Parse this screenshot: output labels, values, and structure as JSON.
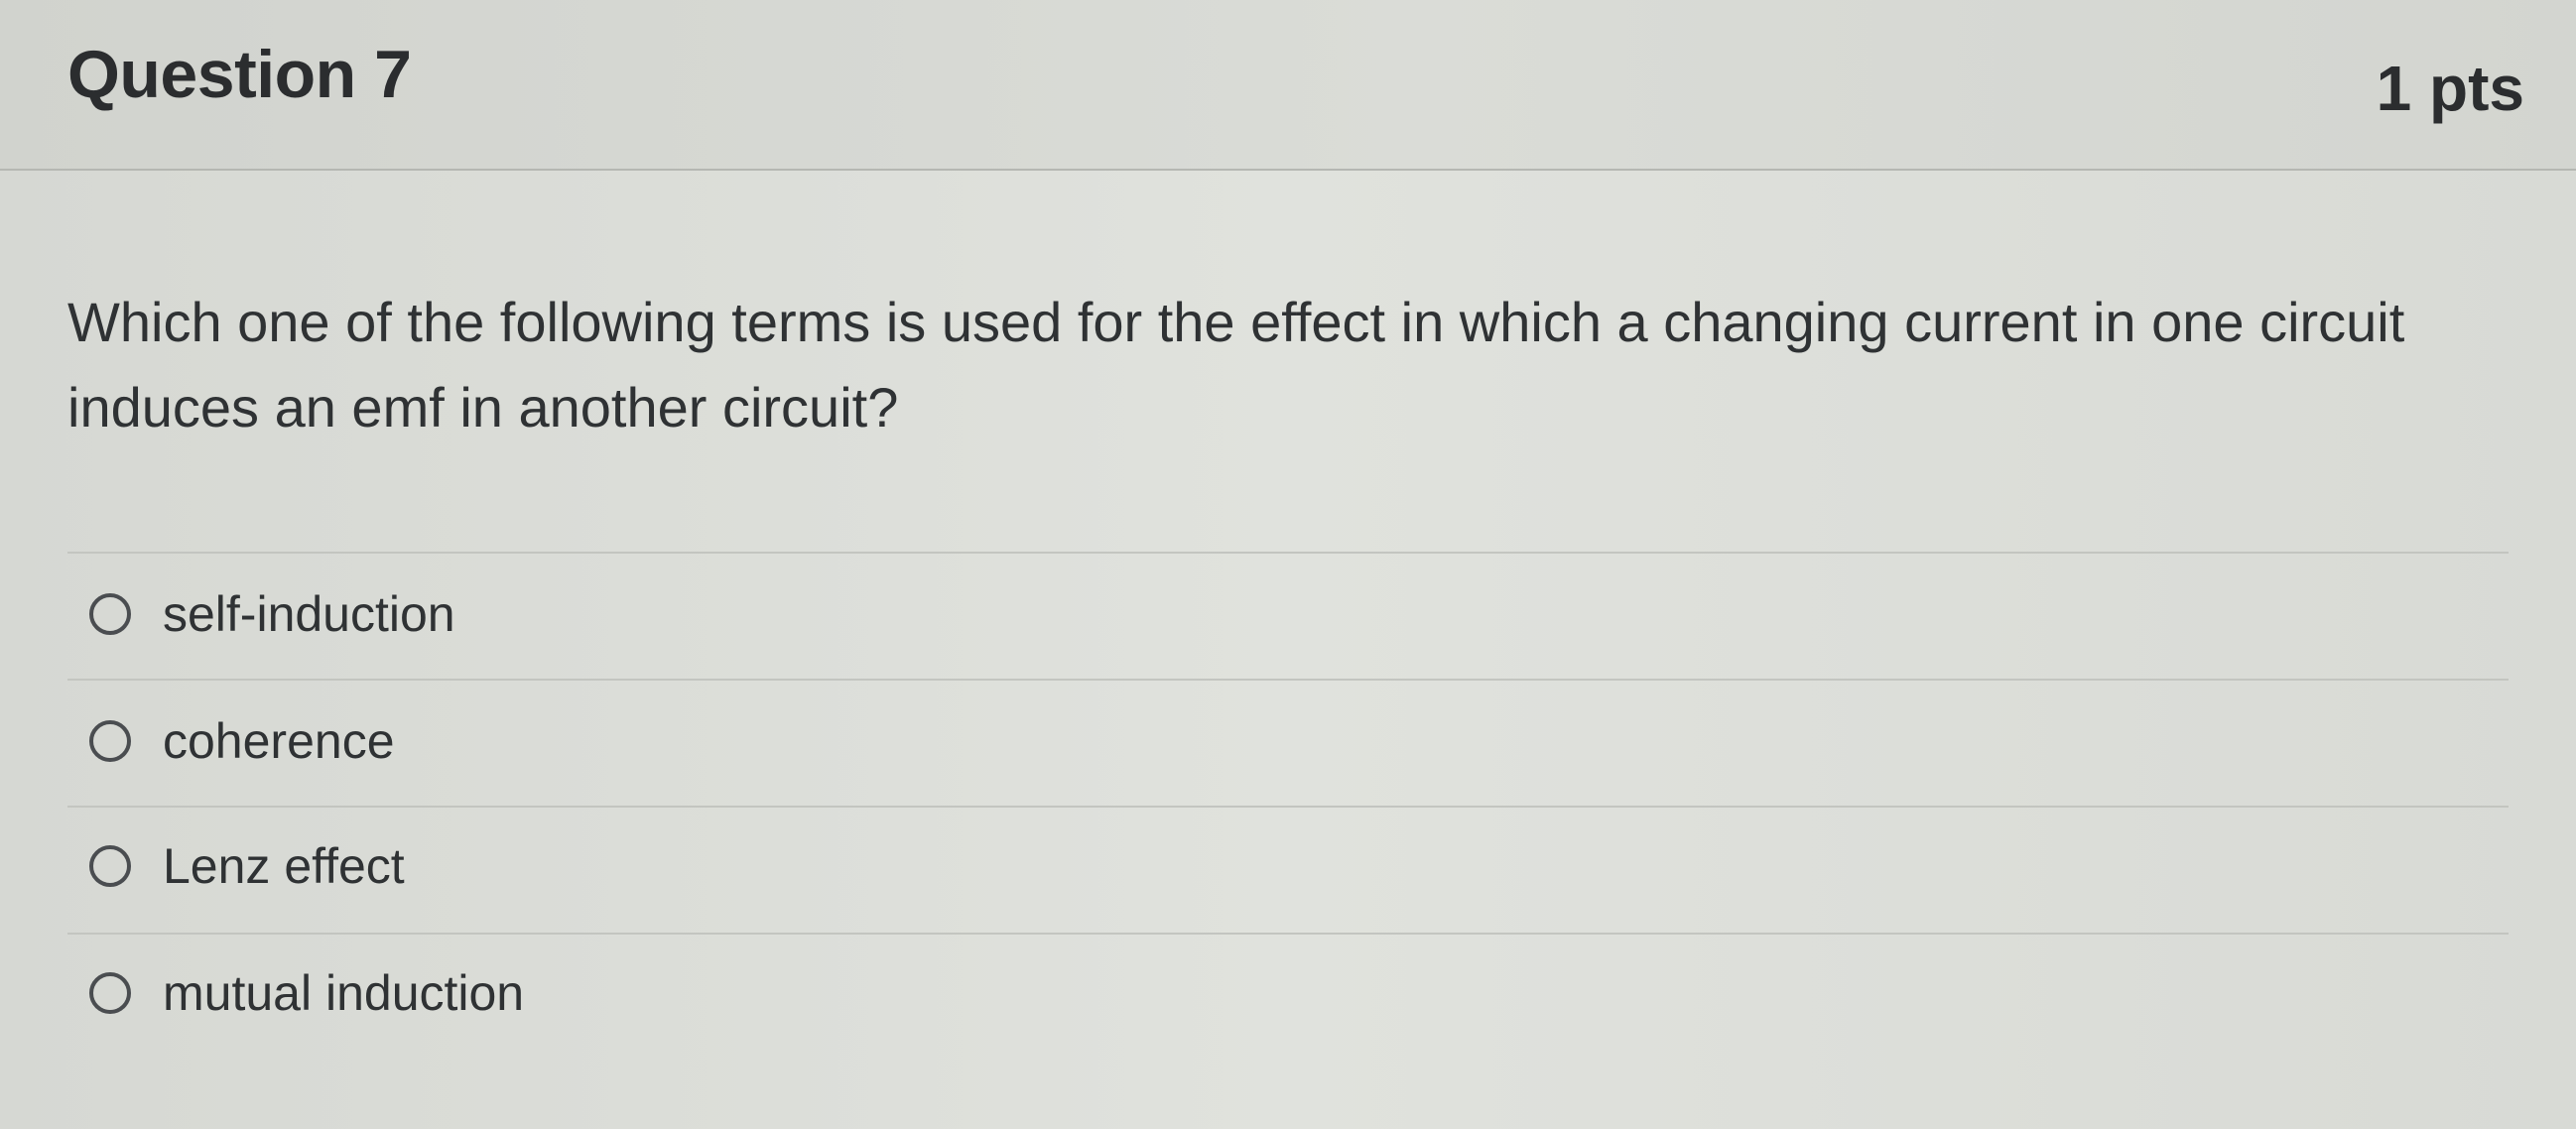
{
  "question": {
    "title": "Question 7",
    "points": "1 pts",
    "text": "Which one of the following terms is used for the effect in which a changing current in one circuit induces an emf in another circuit?"
  },
  "answers": [
    {
      "label": "self-induction"
    },
    {
      "label": "coherence"
    },
    {
      "label": "Lenz effect"
    },
    {
      "label": "mutual induction"
    }
  ]
}
